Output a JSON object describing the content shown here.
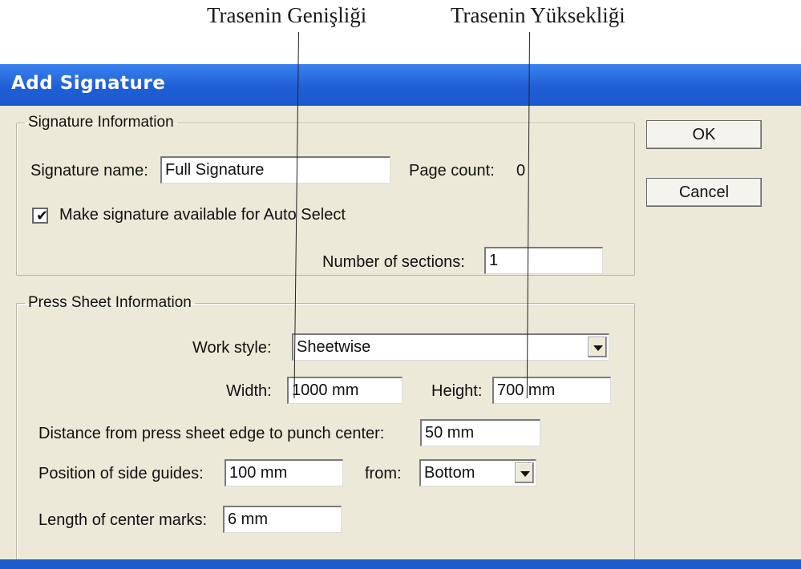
{
  "annotations": {
    "width_label": "Trasenin Genişliği",
    "height_label": "Trasenin Yüksekliği"
  },
  "window": {
    "title": "Add Signature"
  },
  "signature_info": {
    "legend": "Signature Information",
    "name_label": "Signature name:",
    "name_value": "Full Signature",
    "page_count_label": "Page count:",
    "page_count_value": "0",
    "auto_select_label": "Make signature available for Auto Select",
    "auto_select_checked": true,
    "sections_label": "Number of sections:",
    "sections_value": "1"
  },
  "press_sheet": {
    "legend": "Press Sheet Information",
    "work_style_label": "Work style:",
    "work_style_value": "Sheetwise",
    "width_label": "Width:",
    "width_value": "1000 mm",
    "height_label": "Height:",
    "height_value": "700 mm",
    "punch_label": "Distance from press sheet edge to punch center:",
    "punch_value": "50 mm",
    "side_guides_label": "Position of side guides:",
    "side_guides_value": "100 mm",
    "from_label": "from:",
    "from_value": "Bottom",
    "center_marks_label": "Length of center marks:",
    "center_marks_value": "6 mm"
  },
  "buttons": {
    "ok": "OK",
    "cancel": "Cancel"
  },
  "icons": {
    "checkbox": "checkmark-icon",
    "dropdown": "chevron-down-icon"
  }
}
